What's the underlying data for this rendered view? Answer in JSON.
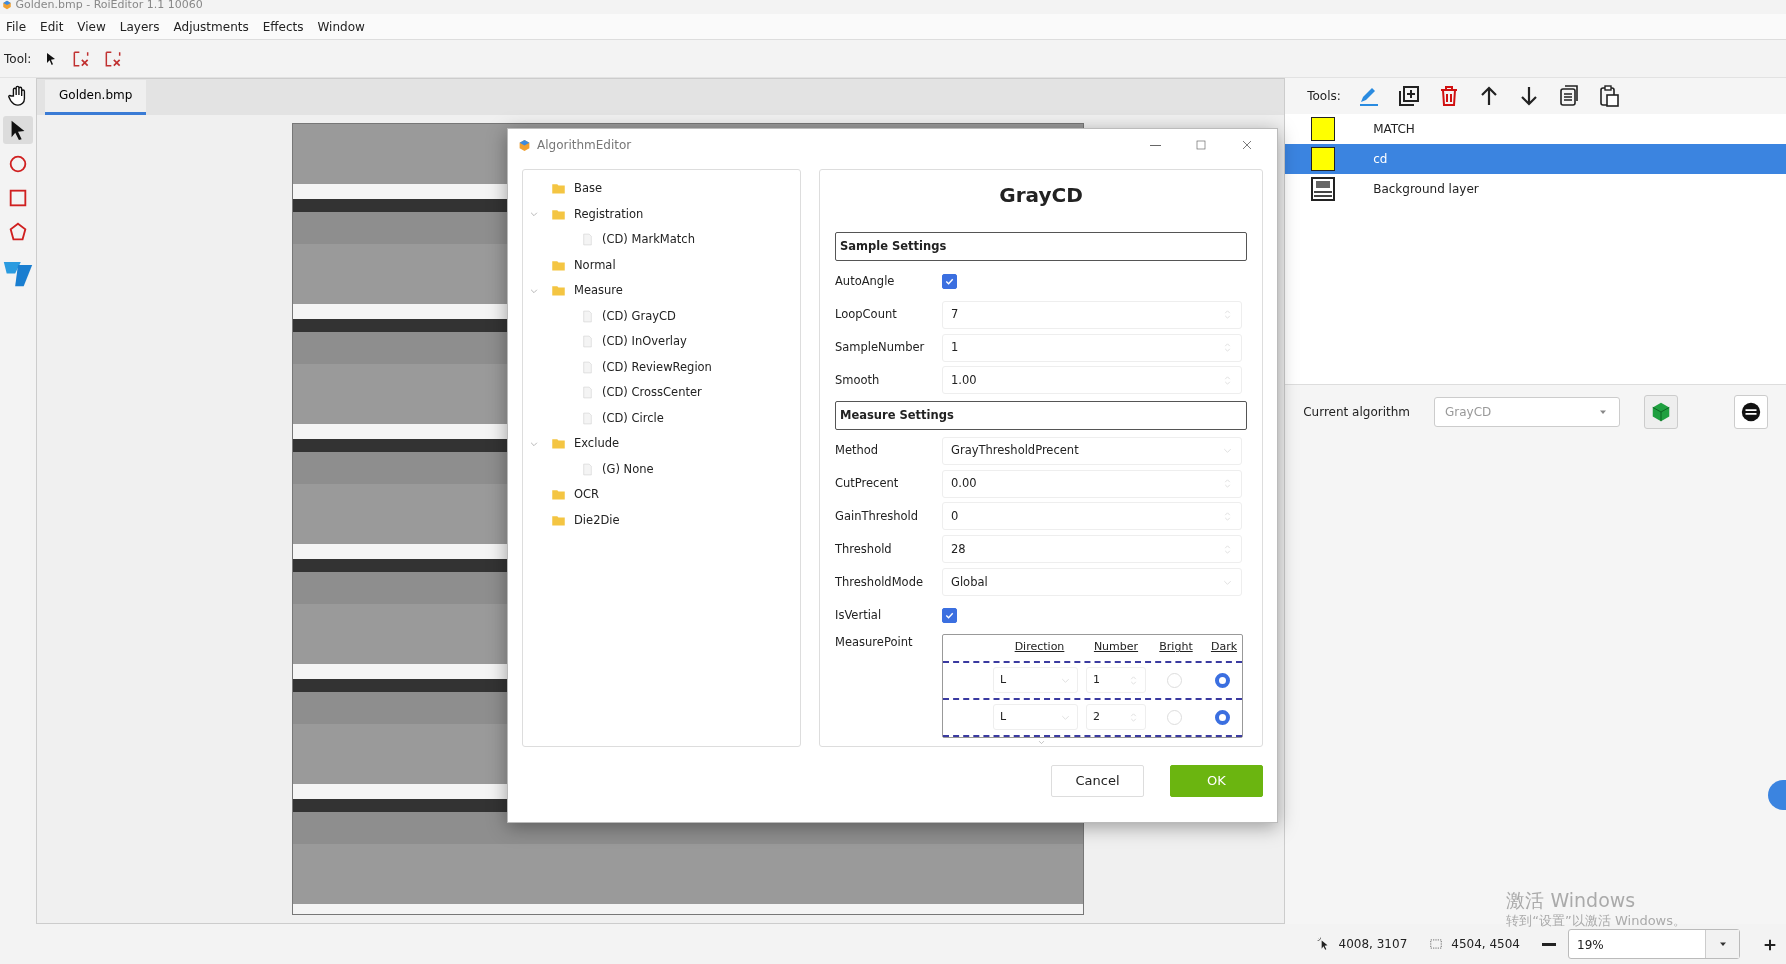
{
  "window": {
    "title": "Golden.bmp - RoiEditor 1.1 10060"
  },
  "menu": [
    "File",
    "Edit",
    "View",
    "Layers",
    "Adjustments",
    "Effects",
    "Window"
  ],
  "toolbar": {
    "label": "Tool:"
  },
  "left_tools": [
    {
      "kind": "hand",
      "selected": false
    },
    {
      "kind": "pointer",
      "selected": true
    },
    {
      "kind": "circle",
      "selected": false
    },
    {
      "kind": "rect",
      "selected": false
    },
    {
      "kind": "polygon",
      "selected": false
    },
    {
      "kind": "logo",
      "selected": false
    }
  ],
  "doc_tabs": [
    {
      "label": "Golden.bmp",
      "selected": true
    }
  ],
  "layers_panel": {
    "tools_label": "Tools:",
    "layers": [
      {
        "name": "MATCH",
        "kind": "shape",
        "color": "#ffff00",
        "selected": false
      },
      {
        "name": "cd",
        "kind": "shape",
        "color": "#ffff00",
        "selected": true
      },
      {
        "name": "Background layer",
        "kind": "image",
        "selected": false
      }
    ],
    "current_algorithm": {
      "label": "Current algorithm",
      "value": "GrayCD"
    }
  },
  "os_notice": {
    "title": "激活 Windows",
    "text": "转到“设置”以激活 Windows。"
  },
  "status_bar": {
    "cursor": "4008, 3107",
    "selection": "4504, 4504",
    "zoom": "19%"
  },
  "dialog": {
    "title": "AlgorithmEditor",
    "tree": [
      {
        "label": "Base",
        "kind": "folder"
      },
      {
        "label": "Registration",
        "kind": "folder",
        "expanded": true,
        "children": [
          {
            "label": "(CD) MarkMatch",
            "kind": "file"
          }
        ]
      },
      {
        "label": "Normal",
        "kind": "folder"
      },
      {
        "label": "Measure",
        "kind": "folder",
        "expanded": true,
        "children": [
          {
            "label": "(CD) GrayCD",
            "kind": "file"
          },
          {
            "label": "(CD) InOverlay",
            "kind": "file"
          },
          {
            "label": "(CD) ReviewRegion",
            "kind": "file"
          },
          {
            "label": "(CD) CrossCenter",
            "kind": "file"
          },
          {
            "label": "(CD) Circle",
            "kind": "file"
          }
        ]
      },
      {
        "label": "Exclude",
        "kind": "folder",
        "expanded": true,
        "children": [
          {
            "label": "(G) None",
            "kind": "file"
          }
        ]
      },
      {
        "label": "OCR",
        "kind": "folder"
      },
      {
        "label": "Die2Die",
        "kind": "folder"
      }
    ],
    "form_title": "GrayCD",
    "sections": [
      {
        "title": "Sample Settings",
        "fields": [
          {
            "label": "AutoAngle",
            "kind": "checkbox",
            "checked": true
          },
          {
            "label": "LoopCount",
            "kind": "spin",
            "value": "7"
          },
          {
            "label": "SampleNumber",
            "kind": "spin",
            "value": "1"
          },
          {
            "label": "Smooth",
            "kind": "spin",
            "value": "1.00"
          }
        ]
      },
      {
        "title": "Measure Settings",
        "fields": [
          {
            "label": "Method",
            "kind": "select",
            "value": "GrayThresholdPrecent"
          },
          {
            "label": "CutPrecent",
            "kind": "spin",
            "value": "0.00"
          },
          {
            "label": "GainThreshold",
            "kind": "spin",
            "value": "0"
          },
          {
            "label": "Threshold",
            "kind": "spin",
            "value": "28"
          },
          {
            "label": "ThresholdMode",
            "kind": "select",
            "value": "Global"
          },
          {
            "label": "IsVertial",
            "kind": "checkbox",
            "checked": true
          }
        ]
      }
    ],
    "measure_point": {
      "label": "MeasurePoint",
      "columns": [
        "Direction",
        "Number",
        "Bright",
        "Dark"
      ],
      "rows": [
        {
          "direction": "L",
          "number": "1",
          "bright_selected": false,
          "dark_selected": true
        },
        {
          "direction": "L",
          "number": "2",
          "bright_selected": false,
          "dark_selected": true
        }
      ]
    },
    "buttons": [
      {
        "label": "Cancel",
        "kind": "secondary"
      },
      {
        "label": "OK",
        "kind": "primary"
      }
    ]
  }
}
